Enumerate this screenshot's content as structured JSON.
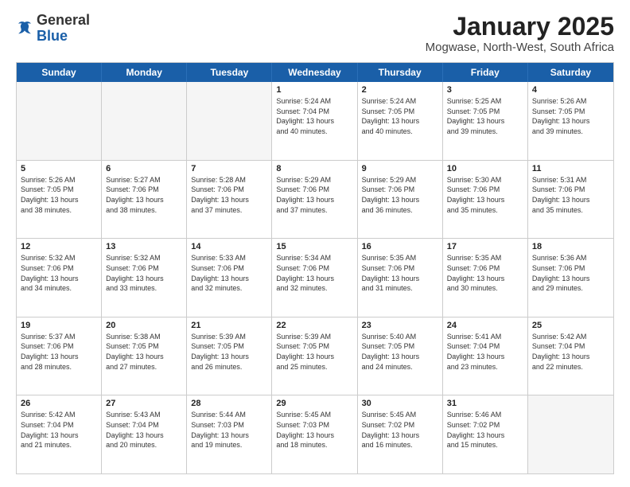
{
  "logo": {
    "general": "General",
    "blue": "Blue"
  },
  "title": "January 2025",
  "subtitle": "Mogwase, North-West, South Africa",
  "header_days": [
    "Sunday",
    "Monday",
    "Tuesday",
    "Wednesday",
    "Thursday",
    "Friday",
    "Saturday"
  ],
  "weeks": [
    [
      {
        "day": "",
        "info": ""
      },
      {
        "day": "",
        "info": ""
      },
      {
        "day": "",
        "info": ""
      },
      {
        "day": "1",
        "info": "Sunrise: 5:24 AM\nSunset: 7:04 PM\nDaylight: 13 hours\nand 40 minutes."
      },
      {
        "day": "2",
        "info": "Sunrise: 5:24 AM\nSunset: 7:05 PM\nDaylight: 13 hours\nand 40 minutes."
      },
      {
        "day": "3",
        "info": "Sunrise: 5:25 AM\nSunset: 7:05 PM\nDaylight: 13 hours\nand 39 minutes."
      },
      {
        "day": "4",
        "info": "Sunrise: 5:26 AM\nSunset: 7:05 PM\nDaylight: 13 hours\nand 39 minutes."
      }
    ],
    [
      {
        "day": "5",
        "info": "Sunrise: 5:26 AM\nSunset: 7:05 PM\nDaylight: 13 hours\nand 38 minutes."
      },
      {
        "day": "6",
        "info": "Sunrise: 5:27 AM\nSunset: 7:06 PM\nDaylight: 13 hours\nand 38 minutes."
      },
      {
        "day": "7",
        "info": "Sunrise: 5:28 AM\nSunset: 7:06 PM\nDaylight: 13 hours\nand 37 minutes."
      },
      {
        "day": "8",
        "info": "Sunrise: 5:29 AM\nSunset: 7:06 PM\nDaylight: 13 hours\nand 37 minutes."
      },
      {
        "day": "9",
        "info": "Sunrise: 5:29 AM\nSunset: 7:06 PM\nDaylight: 13 hours\nand 36 minutes."
      },
      {
        "day": "10",
        "info": "Sunrise: 5:30 AM\nSunset: 7:06 PM\nDaylight: 13 hours\nand 35 minutes."
      },
      {
        "day": "11",
        "info": "Sunrise: 5:31 AM\nSunset: 7:06 PM\nDaylight: 13 hours\nand 35 minutes."
      }
    ],
    [
      {
        "day": "12",
        "info": "Sunrise: 5:32 AM\nSunset: 7:06 PM\nDaylight: 13 hours\nand 34 minutes."
      },
      {
        "day": "13",
        "info": "Sunrise: 5:32 AM\nSunset: 7:06 PM\nDaylight: 13 hours\nand 33 minutes."
      },
      {
        "day": "14",
        "info": "Sunrise: 5:33 AM\nSunset: 7:06 PM\nDaylight: 13 hours\nand 32 minutes."
      },
      {
        "day": "15",
        "info": "Sunrise: 5:34 AM\nSunset: 7:06 PM\nDaylight: 13 hours\nand 32 minutes."
      },
      {
        "day": "16",
        "info": "Sunrise: 5:35 AM\nSunset: 7:06 PM\nDaylight: 13 hours\nand 31 minutes."
      },
      {
        "day": "17",
        "info": "Sunrise: 5:35 AM\nSunset: 7:06 PM\nDaylight: 13 hours\nand 30 minutes."
      },
      {
        "day": "18",
        "info": "Sunrise: 5:36 AM\nSunset: 7:06 PM\nDaylight: 13 hours\nand 29 minutes."
      }
    ],
    [
      {
        "day": "19",
        "info": "Sunrise: 5:37 AM\nSunset: 7:06 PM\nDaylight: 13 hours\nand 28 minutes."
      },
      {
        "day": "20",
        "info": "Sunrise: 5:38 AM\nSunset: 7:05 PM\nDaylight: 13 hours\nand 27 minutes."
      },
      {
        "day": "21",
        "info": "Sunrise: 5:39 AM\nSunset: 7:05 PM\nDaylight: 13 hours\nand 26 minutes."
      },
      {
        "day": "22",
        "info": "Sunrise: 5:39 AM\nSunset: 7:05 PM\nDaylight: 13 hours\nand 25 minutes."
      },
      {
        "day": "23",
        "info": "Sunrise: 5:40 AM\nSunset: 7:05 PM\nDaylight: 13 hours\nand 24 minutes."
      },
      {
        "day": "24",
        "info": "Sunrise: 5:41 AM\nSunset: 7:04 PM\nDaylight: 13 hours\nand 23 minutes."
      },
      {
        "day": "25",
        "info": "Sunrise: 5:42 AM\nSunset: 7:04 PM\nDaylight: 13 hours\nand 22 minutes."
      }
    ],
    [
      {
        "day": "26",
        "info": "Sunrise: 5:42 AM\nSunset: 7:04 PM\nDaylight: 13 hours\nand 21 minutes."
      },
      {
        "day": "27",
        "info": "Sunrise: 5:43 AM\nSunset: 7:04 PM\nDaylight: 13 hours\nand 20 minutes."
      },
      {
        "day": "28",
        "info": "Sunrise: 5:44 AM\nSunset: 7:03 PM\nDaylight: 13 hours\nand 19 minutes."
      },
      {
        "day": "29",
        "info": "Sunrise: 5:45 AM\nSunset: 7:03 PM\nDaylight: 13 hours\nand 18 minutes."
      },
      {
        "day": "30",
        "info": "Sunrise: 5:45 AM\nSunset: 7:02 PM\nDaylight: 13 hours\nand 16 minutes."
      },
      {
        "day": "31",
        "info": "Sunrise: 5:46 AM\nSunset: 7:02 PM\nDaylight: 13 hours\nand 15 minutes."
      },
      {
        "day": "",
        "info": ""
      }
    ]
  ]
}
